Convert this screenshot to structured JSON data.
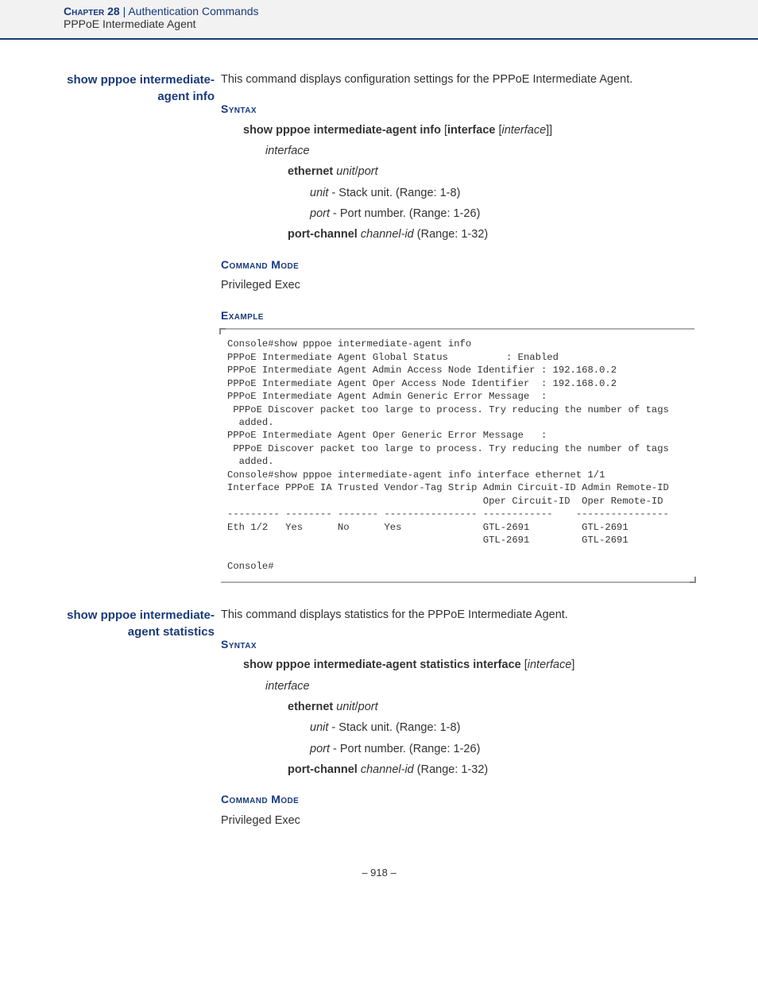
{
  "header": {
    "chapter_label": "Chapter 28",
    "separator": "  |  ",
    "chapter_title": "Authentication Commands",
    "subsection": "PPPoE Intermediate Agent"
  },
  "entries": [
    {
      "side_label": "show pppoe intermediate-agent info",
      "description": "This command displays configuration settings for the PPPoE Intermediate Agent.",
      "syntax_heading": "Syntax",
      "syntax_main_bold": "show pppoe intermediate-agent info",
      "syntax_main_rest_html": " [<b>interface</b> [<i>interface</i>]]",
      "interface_label": "interface",
      "ethernet_bold": "ethernet",
      "ethernet_rest_html": " <i>unit</i>/<i>port</i>",
      "unit_html": "<i>unit</i> - Stack unit. (Range: 1-8)",
      "port_html": "<i>port</i> - Port number. (Range: 1-26)",
      "portchannel_html": "<b>port-channel</b> <i>channel-id</i> (Range: 1-32)",
      "mode_heading": "Command Mode",
      "mode_text": "Privileged Exec",
      "example_heading": "Example",
      "example_text": "Console#show pppoe intermediate-agent info\nPPPoE Intermediate Agent Global Status          : Enabled\nPPPoE Intermediate Agent Admin Access Node Identifier : 192.168.0.2\nPPPoE Intermediate Agent Oper Access Node Identifier  : 192.168.0.2\nPPPoE Intermediate Agent Admin Generic Error Message  :\n PPPoE Discover packet too large to process. Try reducing the number of tags \n  added.\nPPPoE Intermediate Agent Oper Generic Error Message   :\n PPPoE Discover packet too large to process. Try reducing the number of tags \n  added.\nConsole#show pppoe intermediate-agent info interface ethernet 1/1\nInterface PPPoE IA Trusted Vendor-Tag Strip Admin Circuit-ID Admin Remote-ID\n                                            Oper Circuit-ID  Oper Remote-ID\n--------- -------- ------- ---------------- ------------    ----------------\nEth 1/2   Yes      No      Yes              GTL-2691         GTL-2691\n                                            GTL-2691         GTL-2691\n\nConsole#"
    },
    {
      "side_label": "show pppoe intermediate-agent statistics",
      "description": "This command displays statistics for the PPPoE Intermediate Agent.",
      "syntax_heading": "Syntax",
      "syntax_main_bold": "show pppoe intermediate-agent statistics interface",
      "syntax_main_rest_html": " [<i>interface</i>]",
      "interface_label": "interface",
      "ethernet_bold": "ethernet",
      "ethernet_rest_html": " <i>unit</i>/<i>port</i>",
      "unit_html": "<i>unit</i> - Stack unit. (Range: 1-8)",
      "port_html": "<i>port</i> - Port number. (Range: 1-26)",
      "portchannel_html": "<b>port-channel</b> <i>channel-id</i> (Range: 1-32)",
      "mode_heading": "Command Mode",
      "mode_text": "Privileged Exec"
    }
  ],
  "footer": {
    "page_number": "– 918 –"
  }
}
